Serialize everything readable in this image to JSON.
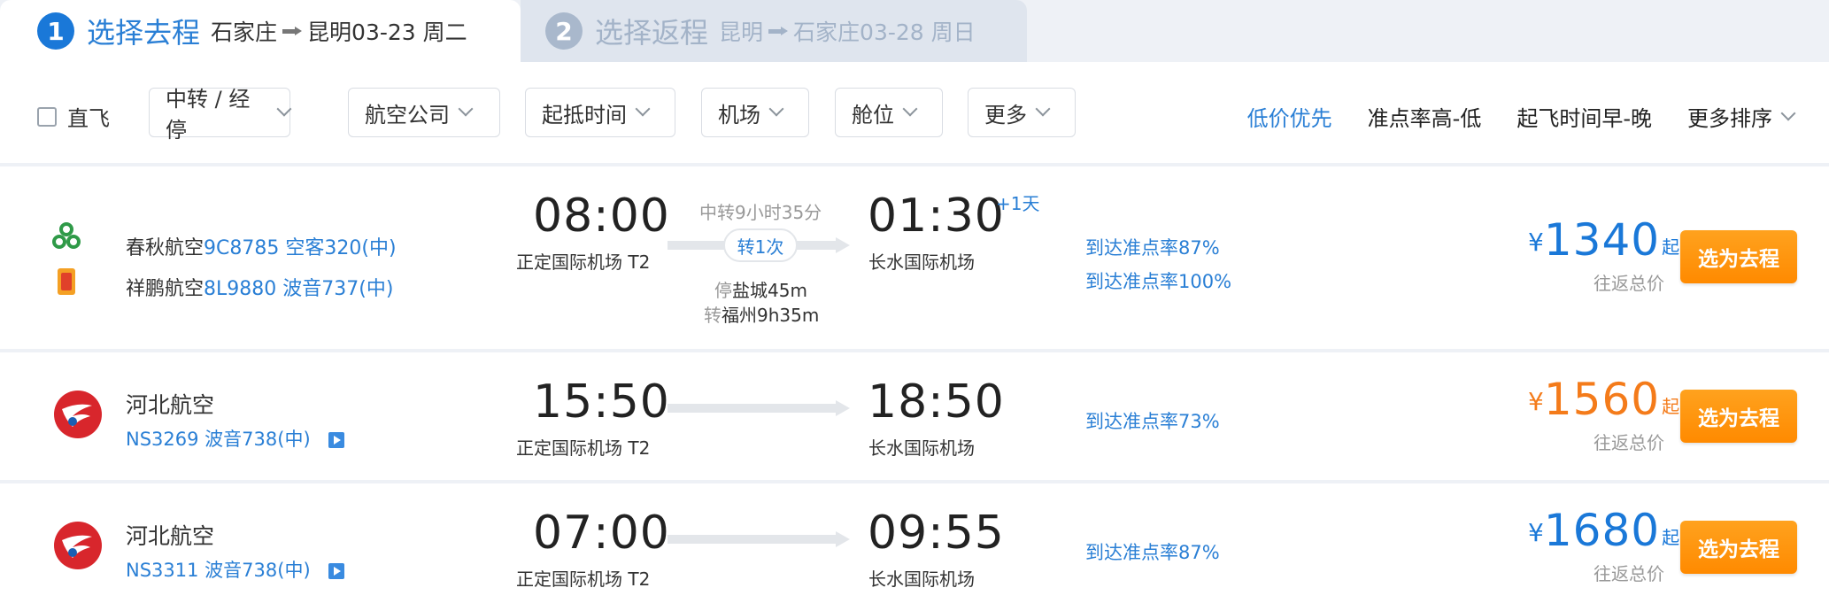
{
  "steps": [
    {
      "num": "1",
      "title": "选择去程",
      "from": "石家庄",
      "to": "昆明",
      "date": "03-23 周二"
    },
    {
      "num": "2",
      "title": "选择返程",
      "from": "昆明",
      "to": "石家庄",
      "date": "03-28 周日"
    }
  ],
  "filters": {
    "direct_label": "直飞",
    "buttons": [
      "中转 / 经停",
      "航空公司",
      "起抵时间",
      "机场",
      "舱位",
      "更多"
    ]
  },
  "sorts": [
    "低价优先",
    "准点率高-低",
    "起飞时间早-晚",
    "更多排序"
  ],
  "colors": {
    "accent": "#2a7fd5",
    "orange": "#f47b1a",
    "button": "#ff9410"
  },
  "flights": [
    {
      "airlines": [
        {
          "name": "春秋航空",
          "flight_no": "9C8785",
          "aircraft": "空客320(中)",
          "logo": "spring-airlines-logo"
        },
        {
          "name": "祥鹏航空",
          "flight_no": "8L9880",
          "aircraft": "波音737(中)",
          "logo": "lucky-air-logo"
        }
      ],
      "dep_time": "08:00",
      "dep_airport": "正定国际机场 T2",
      "arr_time": "01:30",
      "arr_airport": "长水国际机场",
      "plus_day": "+1天",
      "transfer_top": "中转9小时35分",
      "transfer_pill": "转1次",
      "stop1_label": "停",
      "stop1_text": "盐城45m",
      "stop2_label": "转",
      "stop2_text": "福州9h35m",
      "ontime": [
        "到达准点率87%",
        "到达准点率100%"
      ],
      "price_symbol": "¥",
      "price": "1340",
      "price_suffix": "起",
      "price_note": "往返总价",
      "select_label": "选为去程"
    },
    {
      "airline_name": "河北航空",
      "flight_no": "NS3269",
      "aircraft": "波音738(中)",
      "logo": "hebei-airlines-logo",
      "dep_time": "15:50",
      "dep_airport": "正定国际机场 T2",
      "arr_time": "18:50",
      "arr_airport": "长水国际机场",
      "ontime": [
        "到达准点率73%"
      ],
      "price_symbol": "¥",
      "price": "1560",
      "price_suffix": "起",
      "price_note": "往返总价",
      "select_label": "选为去程"
    },
    {
      "airline_name": "河北航空",
      "flight_no": "NS3311",
      "aircraft": "波音738(中)",
      "logo": "hebei-airlines-logo",
      "dep_time": "07:00",
      "dep_airport": "正定国际机场 T2",
      "arr_time": "09:55",
      "arr_airport": "长水国际机场",
      "ontime": [
        "到达准点率87%"
      ],
      "price_symbol": "¥",
      "price": "1680",
      "price_suffix": "起",
      "price_note": "往返总价",
      "select_label": "选为去程"
    }
  ]
}
